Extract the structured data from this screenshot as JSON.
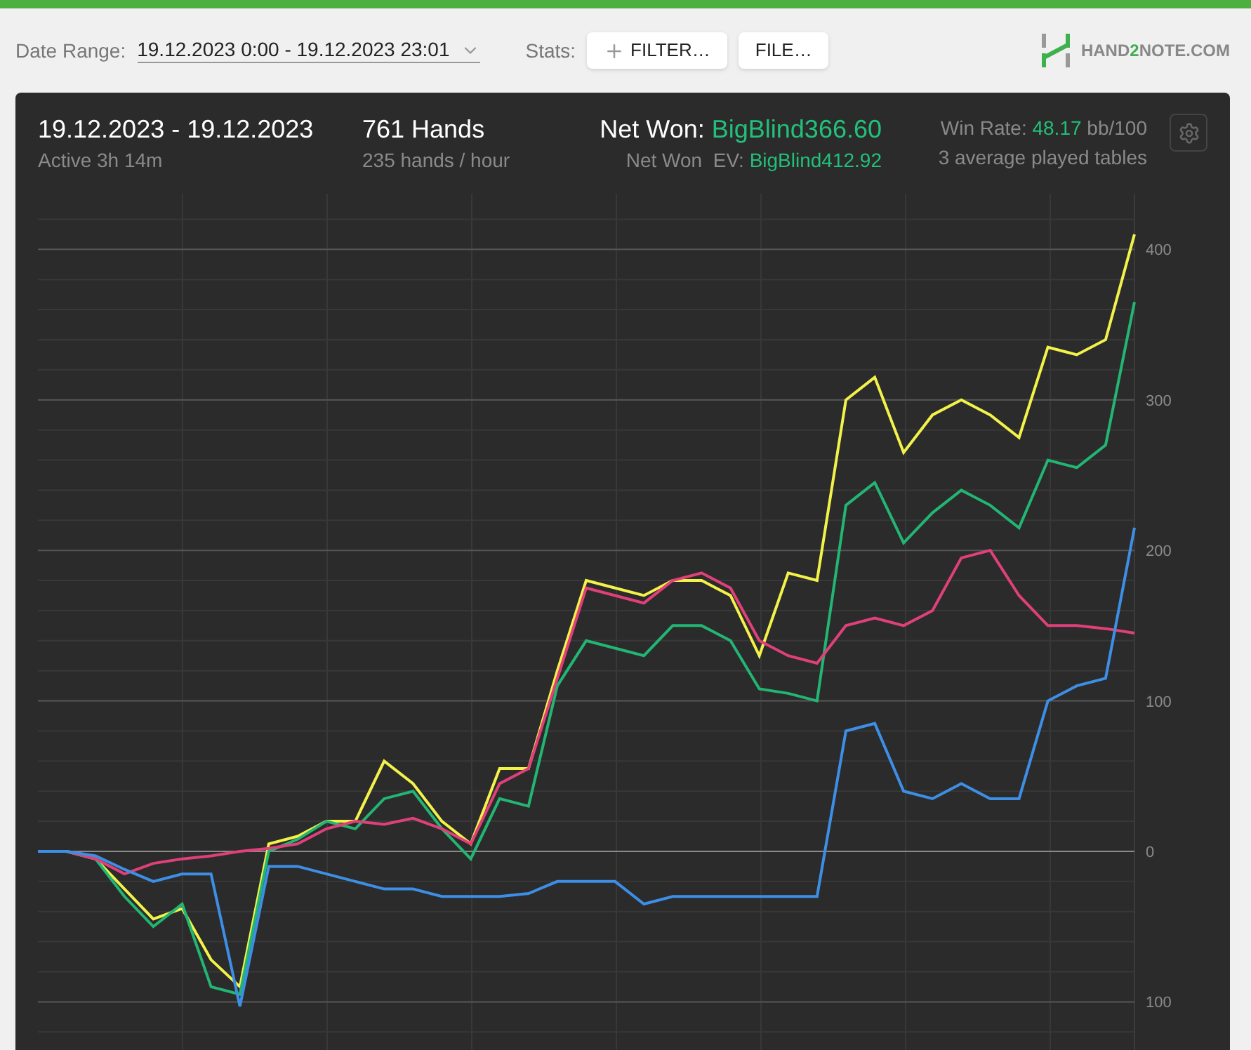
{
  "toolbar": {
    "date_range_label": "Date Range:",
    "date_range_value": "19.12.2023 0:00 - 19.12.2023 23:01",
    "stats_label": "Stats:",
    "buttons": [
      {
        "kind": "add",
        "label": "FILTER…"
      },
      {
        "kind": "plain",
        "label": "FILE…"
      }
    ],
    "logo": {
      "before": "HAND",
      "highlight": "2",
      "after": "NOTE.COM"
    }
  },
  "summary": {
    "date_range": "19.12.2023 - 19.12.2023",
    "active": "Active 3h 14m",
    "hands": "761 Hands",
    "hands_rate": "235 hands / hour",
    "net_won_label": "Net Won:",
    "net_won_value": "BigBlind366.60",
    "net_won_ev_label": "Net Won  EV:",
    "net_won_ev_value": "BigBlind412.92",
    "win_rate_label": "Win Rate:",
    "win_rate_value": "48.17",
    "win_rate_unit": "bb/100",
    "tables": "3 average played tables"
  },
  "chart_data": {
    "type": "line",
    "grid": true,
    "categories": [
      null,
      null,
      null,
      null,
      null,
      null,
      null,
      null,
      null,
      null,
      null,
      null,
      null,
      null,
      null,
      null,
      null,
      null,
      null,
      null,
      null,
      null,
      null,
      null,
      null,
      null,
      null,
      null,
      null,
      null,
      null,
      null,
      null,
      null,
      null,
      null,
      null,
      null,
      null
    ],
    "ylim": [
      -132,
      437
    ],
    "yticks": [
      {
        "value": -100,
        "label": "100"
      },
      0,
      100,
      200,
      300,
      400
    ],
    "series": [
      {
        "color": "#f2f24a",
        "values": [
          0,
          0,
          -5,
          -25,
          -45,
          -38,
          -72,
          -90,
          5,
          10,
          20,
          20,
          60,
          45,
          20,
          5,
          55,
          55,
          120,
          180,
          175,
          170,
          180,
          180,
          170,
          130,
          185,
          180,
          300,
          315,
          265,
          290,
          300,
          290,
          275,
          335,
          330,
          340,
          410
        ]
      },
      {
        "color": "#22b573",
        "values": [
          0,
          0,
          -5,
          -30,
          -50,
          -35,
          -90,
          -95,
          0,
          8,
          20,
          15,
          35,
          40,
          15,
          -5,
          35,
          30,
          110,
          140,
          135,
          130,
          150,
          150,
          140,
          108,
          105,
          100,
          230,
          245,
          205,
          225,
          240,
          230,
          215,
          260,
          255,
          270,
          365
        ]
      },
      {
        "color": "#e0407a",
        "values": [
          0,
          0,
          -5,
          -15,
          -8,
          -5,
          -3,
          0,
          2,
          5,
          15,
          20,
          18,
          22,
          15,
          5,
          45,
          55,
          115,
          175,
          170,
          165,
          180,
          185,
          175,
          140,
          130,
          125,
          150,
          155,
          150,
          160,
          195,
          200,
          170,
          150,
          150,
          148,
          145
        ]
      },
      {
        "color": "#3d8fe6",
        "values": [
          0,
          0,
          -3,
          -12,
          -20,
          -15,
          -15,
          -103,
          -10,
          -10,
          -15,
          -20,
          -25,
          -25,
          -30,
          -30,
          -30,
          -28,
          -20,
          -20,
          -20,
          -35,
          -30,
          -30,
          -30,
          -30,
          -30,
          -30,
          80,
          85,
          40,
          35,
          45,
          35,
          35,
          100,
          110,
          115,
          215
        ]
      }
    ]
  }
}
